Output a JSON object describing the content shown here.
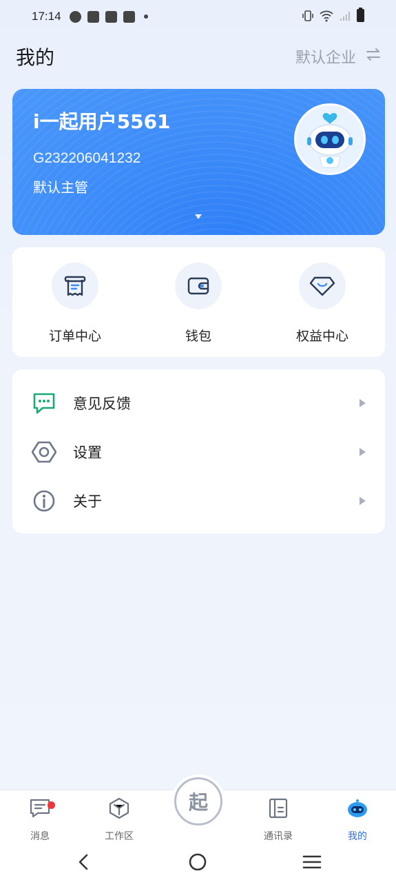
{
  "status_bar": {
    "time": "17:14"
  },
  "header": {
    "title": "我的",
    "company": "默认企业"
  },
  "profile": {
    "name": "i一起用户5561",
    "id": "G232206041232",
    "role": "默认主管"
  },
  "quick_actions": [
    {
      "label": "订单中心",
      "icon": "receipt-icon"
    },
    {
      "label": "钱包",
      "icon": "wallet-icon"
    },
    {
      "label": "权益中心",
      "icon": "diamond-icon"
    }
  ],
  "menu": [
    {
      "label": "意见反馈",
      "icon": "feedback-icon",
      "color": "#19a974"
    },
    {
      "label": "设置",
      "icon": "settings-icon",
      "color": "#6b7787"
    },
    {
      "label": "关于",
      "icon": "info-icon",
      "color": "#6b7787"
    }
  ],
  "tabbar": {
    "items": [
      {
        "label": "消息",
        "icon": "message-icon",
        "badge": true
      },
      {
        "label": "工作区",
        "icon": "cube-icon"
      },
      {
        "label": "通讯录",
        "icon": "contacts-icon"
      },
      {
        "label": "我的",
        "icon": "robot-icon",
        "active": true
      }
    ],
    "center_label": "起"
  },
  "colors": {
    "accent": "#2d6fe0",
    "card": "#3b8af9",
    "badge": "#f0343a"
  }
}
